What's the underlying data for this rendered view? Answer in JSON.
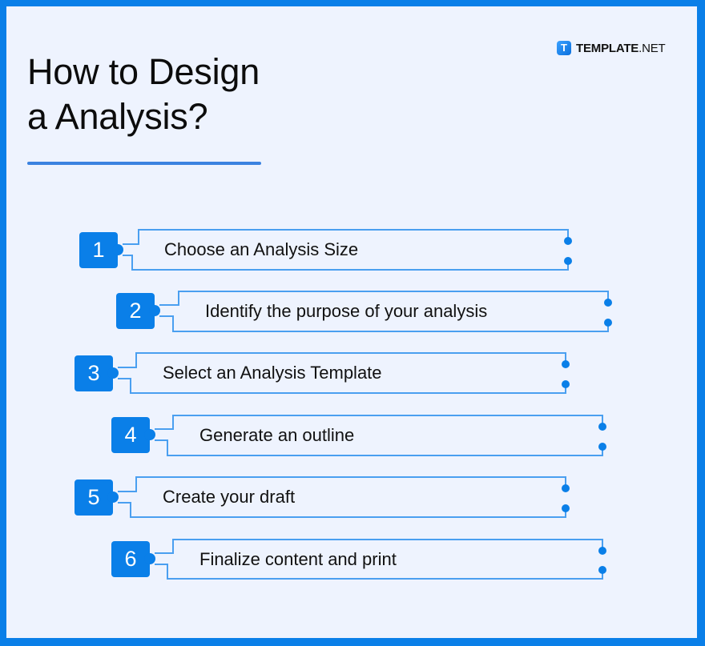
{
  "title": {
    "line1": "How to Design",
    "line2": "a Analysis?"
  },
  "brand": {
    "logo_letter": "T",
    "name": "TEMPLATE",
    "tld": ".NET"
  },
  "colors": {
    "accent": "#0a7fe8",
    "line": "#4a9ff0",
    "background": "#eef3fe",
    "underline": "#3b82e0",
    "text": "#111111"
  },
  "steps": [
    {
      "number": "1",
      "label": "Choose an Analysis Size"
    },
    {
      "number": "2",
      "label": "Identify the purpose of your analysis"
    },
    {
      "number": "3",
      "label": "Select an Analysis Template"
    },
    {
      "number": "4",
      "label": "Generate an outline"
    },
    {
      "number": "5",
      "label": "Create your draft"
    },
    {
      "number": "6",
      "label": "Finalize content and print"
    }
  ]
}
